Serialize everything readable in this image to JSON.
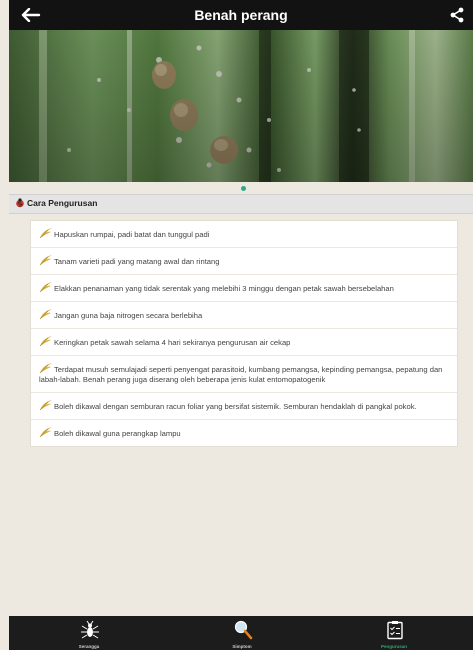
{
  "header": {
    "title": "Benah perang",
    "back_icon": "back-arrow-icon",
    "share_icon": "share-icon"
  },
  "hero": {
    "description": "",
    "carousel_dots": 1,
    "accent": "#2ea88a"
  },
  "section": {
    "title": "Cara Pengurusan",
    "icon": "ladybug-icon"
  },
  "items": [
    {
      "text": "Hapuskan rumpai, padi batat dan tunggul padi"
    },
    {
      "text": "Tanam varieti padi yang matang awal dan rintang"
    },
    {
      "text": "Elakkan penanaman yang tidak serentak yang melebihi 3 minggu dengan petak sawah bersebelahan"
    },
    {
      "text": "Jangan guna baja nitrogen secara berlebiha"
    },
    {
      "text": "Keringkan petak sawah selama 4 hari sekiranya pengurusan air cekap"
    },
    {
      "text": "Terdapat musuh semulajadi seperti penyengat parasitoid, kumbang pemangsa, kepinding pemangsa, pepatung dan labah-labah. Benah perang juga diserang oleh beberapa jenis kulat entomopatogenik"
    },
    {
      "text": "Boleh dikawal dengan semburan racun foliar yang bersifat sistemik. Semburan hendaklah di pangkal pokok."
    },
    {
      "text": "Boleh dikawal guna perangkap lampu"
    }
  ],
  "bottom_tabs": [
    {
      "label": "Serangga",
      "icon": "insect-icon",
      "active": false
    },
    {
      "label": "Simptom",
      "icon": "magnifier-icon",
      "active": false
    },
    {
      "label": "Pengurusan",
      "icon": "checklist-icon",
      "active": true
    }
  ]
}
